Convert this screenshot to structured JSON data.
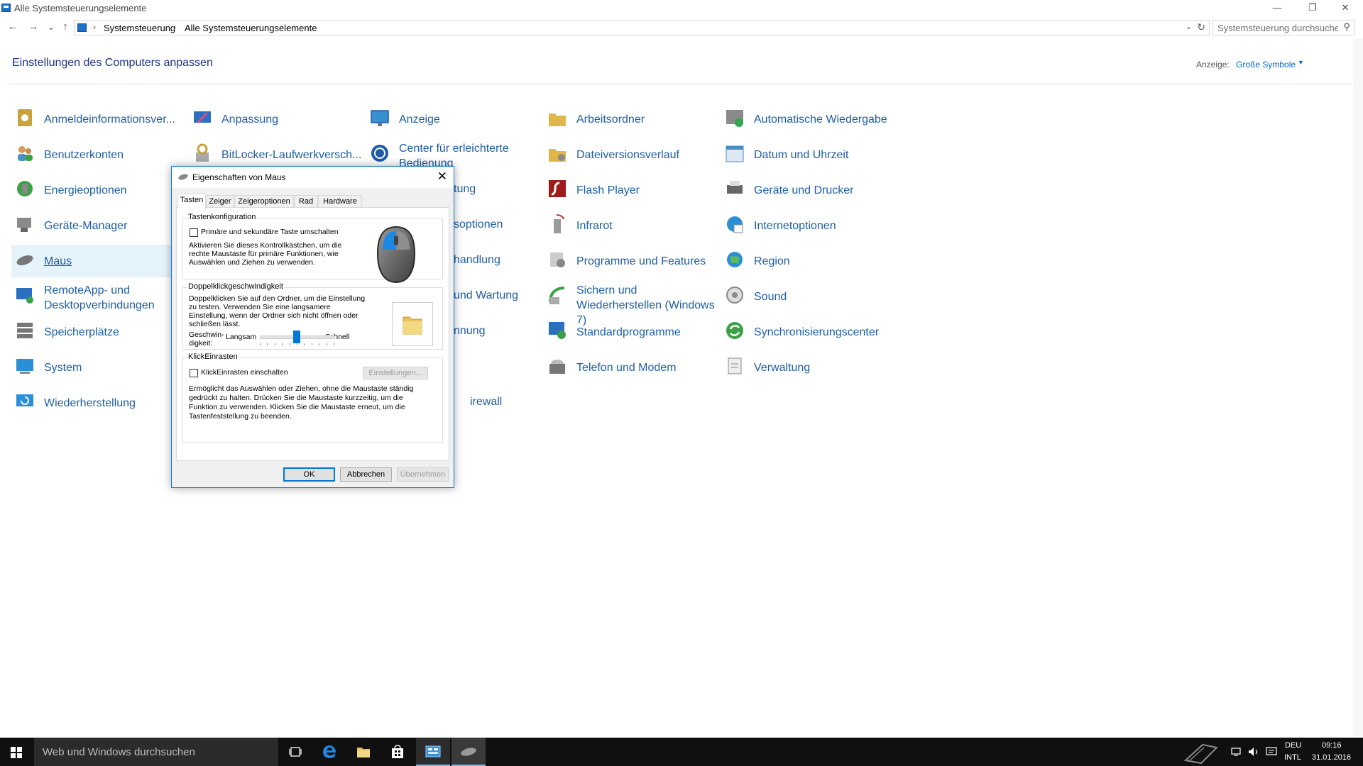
{
  "window": {
    "title": "Alle Systemsteuerungselemente",
    "btn_minimize": "—",
    "btn_restore": "❐",
    "btn_close": "✕"
  },
  "nav": {
    "back": "←",
    "forward": "→",
    "recent": "⌄",
    "up": "↑"
  },
  "address": {
    "crumbs": [
      "Systemsteuerung",
      "Alle Systemsteuerungselemente"
    ],
    "sep": "›",
    "dropdown": "⌄",
    "refresh": "↻"
  },
  "search": {
    "placeholder": "Systemsteuerung durchsuchen",
    "icon": "⚲"
  },
  "header": {
    "heading": "Einstellungen des Computers anpassen",
    "view_label": "Anzeige:",
    "view_value": "Große Symbole",
    "view_caret": "▼"
  },
  "items": [
    {
      "label": "Anmeldeinformationsver...",
      "icon": "credential-vault-icon",
      "color": "#c8a23a"
    },
    {
      "label": "Anpassung",
      "icon": "personalization-icon",
      "color": "#3a78c9"
    },
    {
      "label": "Anzeige",
      "icon": "display-icon",
      "color": "#3a8fd0"
    },
    {
      "label": "Arbeitsordner",
      "icon": "work-folders-icon",
      "color": "#e0b84a"
    },
    {
      "label": "Automatische Wiedergabe",
      "icon": "autoplay-icon",
      "color": "#2fa84f"
    },
    {
      "label": "Benutzerkonten",
      "icon": "user-accounts-icon",
      "color": "#4a8fc4"
    },
    {
      "label": "BitLocker-Laufwerkversch...",
      "icon": "bitlocker-icon",
      "color": "#c8a23a"
    },
    {
      "label": "Center für erleichterte Bedienung",
      "icon": "ease-of-access-icon",
      "color": "#1e5aa8"
    },
    {
      "label": "Dateiversionsverlauf",
      "icon": "file-history-icon",
      "color": "#e0b84a"
    },
    {
      "label": "Datum und Uhrzeit",
      "icon": "date-time-icon",
      "color": "#4a8fc4"
    },
    {
      "label": "Energieoptionen",
      "icon": "power-options-icon",
      "color": "#3ba046"
    },
    {
      "label": "Flash Player",
      "icon": "flash-player-icon",
      "color": "#9e1b1b"
    },
    {
      "label": "Geräte und Drucker",
      "icon": "devices-printers-icon",
      "color": "#666666"
    },
    {
      "label": "Geräte-Manager",
      "icon": "device-manager-icon",
      "color": "#666666"
    },
    {
      "label": "Infrarot",
      "icon": "infrared-icon",
      "color": "#c03030"
    },
    {
      "label": "Internetoptionen",
      "icon": "internet-options-icon",
      "color": "#2a8fd6"
    },
    {
      "label": "Maus",
      "icon": "mouse-icon",
      "color": "#777777"
    },
    {
      "label": "Programme und Features",
      "icon": "programs-features-icon",
      "color": "#888888"
    },
    {
      "label": "Region",
      "icon": "region-icon",
      "color": "#2a8fd6"
    },
    {
      "label": "RemoteApp- und Desktopverbindungen",
      "icon": "remoteapp-icon",
      "color": "#2a6fc0"
    },
    {
      "label": "Sichern und Wiederherstellen (Windows 7)",
      "icon": "backup-restore-icon",
      "color": "#3ba046"
    },
    {
      "label": "Sound",
      "icon": "sound-icon",
      "color": "#888888"
    },
    {
      "label": "Speicherplätze",
      "icon": "storage-spaces-icon",
      "color": "#777777"
    },
    {
      "label": "Standardprogramme",
      "icon": "default-programs-icon",
      "color": "#2a6fc0"
    },
    {
      "label": "Synchronisierungscenter",
      "icon": "sync-center-icon",
      "color": "#3ba046"
    },
    {
      "label": "System",
      "icon": "system-icon",
      "color": "#2a8fd6"
    },
    {
      "label": "Telefon und Modem",
      "icon": "phone-modem-icon",
      "color": "#777777"
    },
    {
      "label": "Verwaltung",
      "icon": "administrative-tools-icon",
      "color": "#888888"
    },
    {
      "label": "Wiederherstellung",
      "icon": "recovery-icon",
      "color": "#2a8fd6"
    }
  ],
  "hidden_fragments": [
    "tung",
    "soptionen",
    "handlung",
    "und Wartung",
    "nnung",
    "irewall"
  ],
  "dialog": {
    "title": "Eigenschaften von Maus",
    "close": "✕",
    "tabs": [
      "Tasten",
      "Zeiger",
      "Zeigeroptionen",
      "Rad",
      "Hardware"
    ],
    "group1": {
      "title": "Tastenkonfiguration",
      "checkbox": "Primäre und sekundäre Taste umschalten",
      "desc": [
        "Aktivieren Sie dieses Kontrollkästchen, um die",
        "rechte Maustaste für primäre Funktionen, wie",
        "Auswählen und Ziehen zu verwenden."
      ]
    },
    "group2": {
      "title": "Doppelklickgeschwindigkeit",
      "desc": [
        "Doppelklicken Sie auf den Ordner, um die Einstellung",
        "zu testen. Verwenden Sie eine langsamere",
        "Einstellung, wenn der Ordner sich nicht öffnen oder",
        "schließen lässt."
      ],
      "speed_label": [
        "Geschwin-",
        "digkeit:"
      ],
      "slow": "Langsam",
      "fast": "Schnell",
      "speed_fraction": 0.5
    },
    "group3": {
      "title": "KlickEinrasten",
      "checkbox": "KlickEinrasten einschalten",
      "settings": "Einstellungen...",
      "desc": [
        "Ermöglicht das Auswählen oder Ziehen, ohne die Maustaste ständig",
        "gedrückt zu halten. Drücken Sie die Maustaste kurzzeitig, um die",
        "Funktion zu verwenden. Klicken Sie die Maustaste erneut, um die",
        "Tastenfeststellung zu beenden."
      ]
    },
    "ok": "OK",
    "cancel": "Abbrechen",
    "apply": "Übernehmen"
  },
  "taskbar": {
    "search_placeholder": "Web und Windows durchsuchen",
    "lang_top": "DEU",
    "lang_bottom": "INTL",
    "time": "09:16",
    "date": "31.01.2016"
  }
}
